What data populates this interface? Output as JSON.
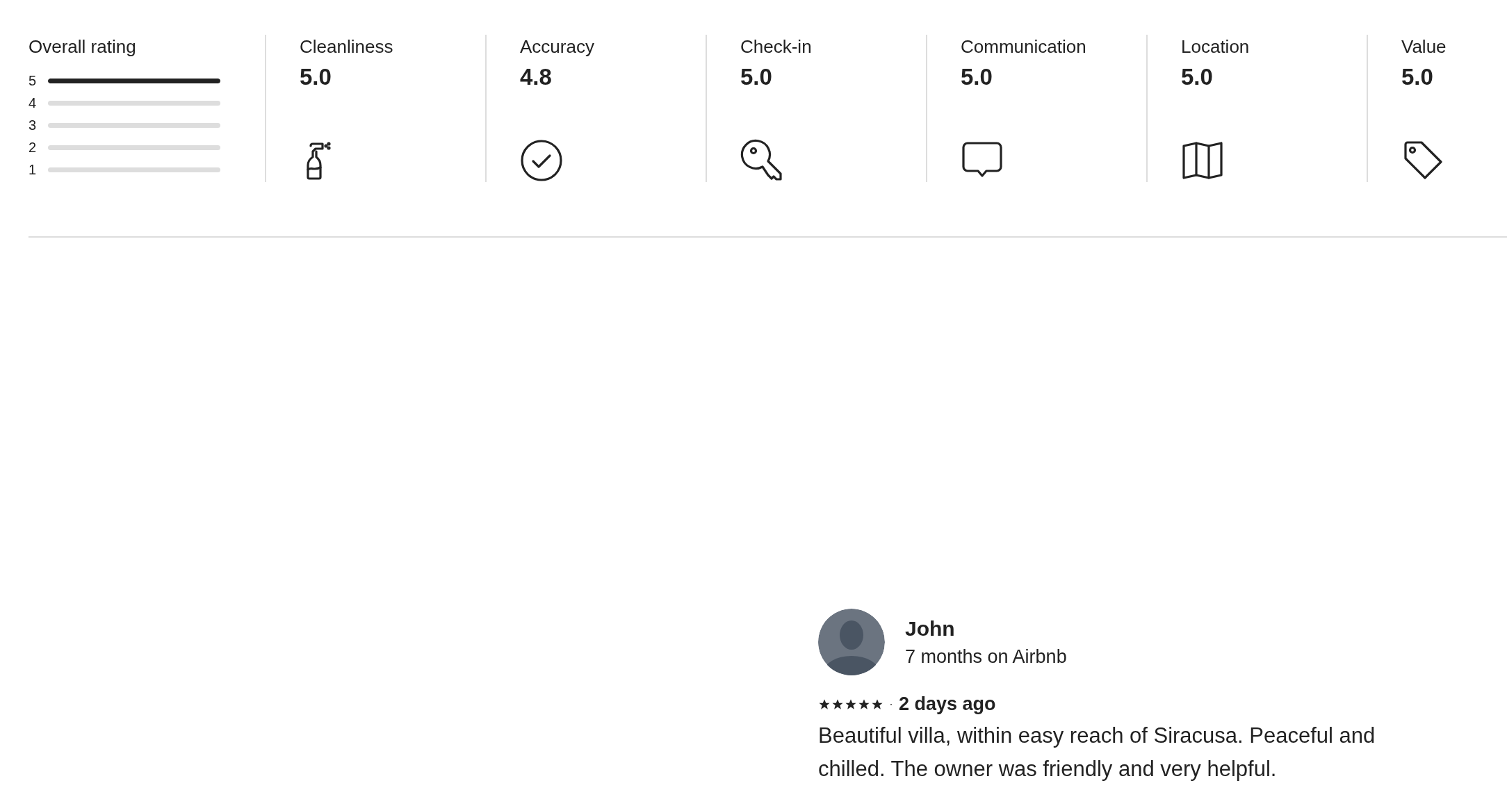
{
  "overall": {
    "title": "Overall rating",
    "rows": [
      {
        "label": "5",
        "level": 1
      },
      {
        "label": "4",
        "level": 0
      },
      {
        "label": "3",
        "level": 0
      },
      {
        "label": "2",
        "level": 0
      },
      {
        "label": "1",
        "level": 0
      }
    ]
  },
  "categories": [
    {
      "label": "Cleanliness",
      "value": "5.0",
      "kind": "spray"
    },
    {
      "label": "Accuracy",
      "value": "4.8",
      "kind": "check"
    },
    {
      "label": "Check-in",
      "value": "5.0",
      "kind": "key"
    },
    {
      "label": "Communication",
      "value": "5.0",
      "kind": "chat"
    },
    {
      "label": "Location",
      "value": "5.0",
      "kind": "map"
    },
    {
      "label": "Value",
      "value": "5.0",
      "kind": "tag"
    }
  ],
  "review": {
    "name": "John",
    "tenure": "7 months on Airbnb",
    "stars": 5,
    "separator": "·",
    "date": "2 days ago",
    "text": "Beautiful villa, within easy reach of Siracusa. Peaceful and chilled. The owner was friendly and very helpful."
  }
}
